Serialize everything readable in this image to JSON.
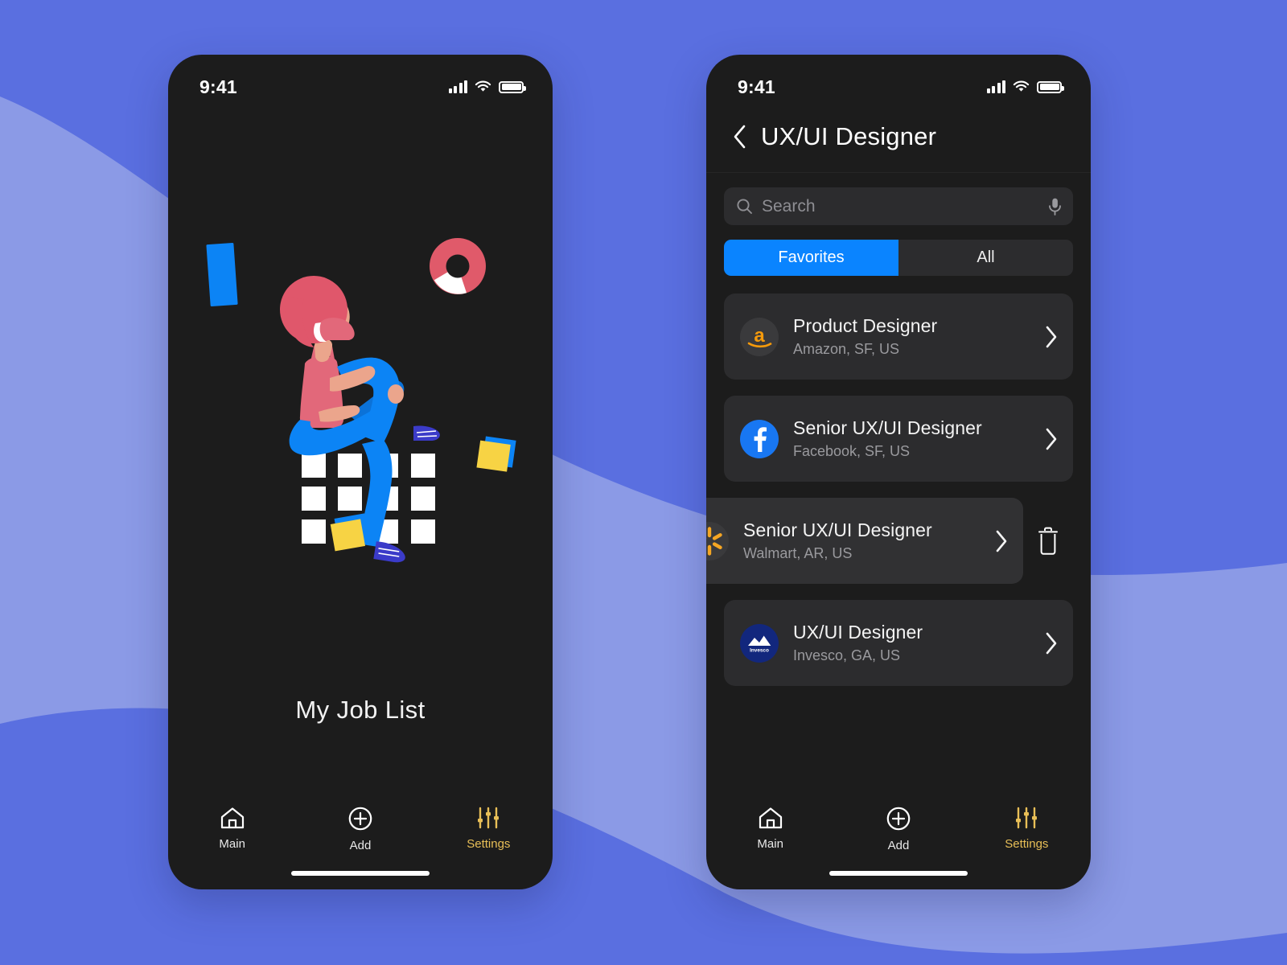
{
  "background": {
    "light_blue": "#8b9ae6",
    "dark_blue": "#5a6fe0"
  },
  "theme": {
    "screen_bg": "#1c1c1c",
    "card_bg": "#2c2c2e",
    "accent_blue": "#0a84ff",
    "accent_yellow": "#e8bf57",
    "text_primary": "#f4f4f4",
    "text_secondary": "#9a9a9e"
  },
  "left_screen": {
    "status": {
      "time": "9:41",
      "signal_icon": "signal-bars-icon",
      "wifi_icon": "wifi-icon",
      "battery_icon": "battery-full-icon"
    },
    "illustration": {
      "name": "woman-sitting-on-grid-illustration",
      "hair_color": "#e0576b",
      "shirt_color": "#e2687a",
      "jeans_color": "#0c84f5",
      "skin_color": "#eba58c",
      "accent_yellow": "#f7d344",
      "grid_color": "#ffffff",
      "donut_color": "#e05a6a"
    },
    "title": "My Job List",
    "tabbar": [
      {
        "label": "Main",
        "icon": "home-icon",
        "active": false
      },
      {
        "label": "Add",
        "icon": "plus-circle-icon",
        "active": false
      },
      {
        "label": "Settings",
        "icon": "sliders-icon",
        "active": true
      }
    ]
  },
  "right_screen": {
    "status": {
      "time": "9:41",
      "signal_icon": "signal-bars-icon",
      "wifi_icon": "wifi-icon",
      "battery_icon": "battery-full-icon"
    },
    "header": {
      "back_icon": "chevron-left-icon",
      "title": "UX/UI Designer"
    },
    "search": {
      "placeholder": "Search",
      "value": "",
      "search_icon": "search-icon",
      "mic_icon": "microphone-icon"
    },
    "segments": [
      {
        "label": "Favorites",
        "selected": true
      },
      {
        "label": "All",
        "selected": false
      }
    ],
    "jobs": [
      {
        "title": "Product Designer",
        "subtitle": "Amazon, SF, US",
        "logo": "amazon-logo",
        "swiped": false,
        "chevron_icon": "chevron-right-icon"
      },
      {
        "title": "Senior UX/UI Designer",
        "subtitle": "Facebook, SF, US",
        "logo": "facebook-logo",
        "swiped": false,
        "chevron_icon": "chevron-right-icon"
      },
      {
        "title": "Senior UX/UI Designer",
        "subtitle": "Walmart, AR, US",
        "logo": "walmart-logo",
        "swiped": true,
        "chevron_icon": "chevron-right-icon",
        "delete_icon": "trash-icon"
      },
      {
        "title": "UX/UI Designer",
        "subtitle": "Invesco, GA, US",
        "logo": "invesco-logo",
        "swiped": false,
        "chevron_icon": "chevron-right-icon"
      }
    ],
    "tabbar": [
      {
        "label": "Main",
        "icon": "home-icon",
        "active": false
      },
      {
        "label": "Add",
        "icon": "plus-circle-icon",
        "active": false
      },
      {
        "label": "Settings",
        "icon": "sliders-icon",
        "active": true
      }
    ]
  }
}
